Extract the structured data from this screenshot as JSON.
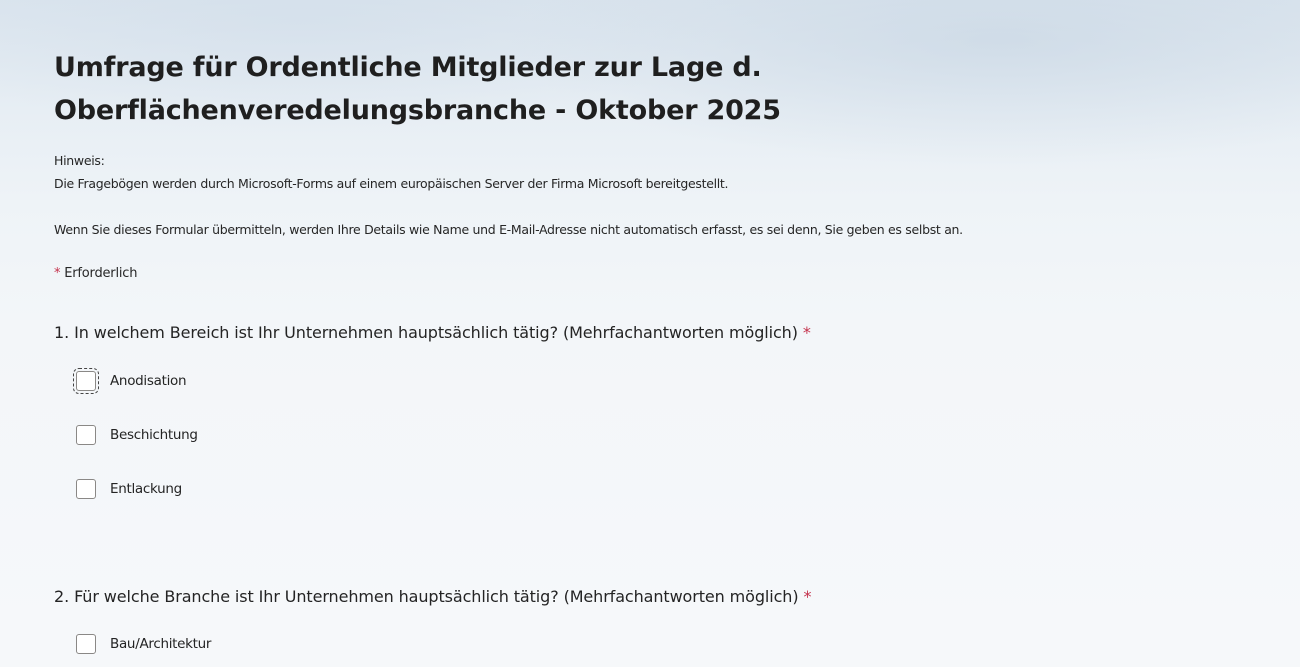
{
  "form": {
    "title": "Umfrage für Ordentliche Mitglieder zur Lage d. Oberflächenveredelungsbranche - Oktober 2025",
    "description": {
      "line1": "Hinweis:",
      "line2": "Die Fragebögen werden durch Microsoft-Forms auf einem europäischen Server der Firma Microsoft bereitgestellt.",
      "line3": "Wenn Sie dieses Formular übermitteln, werden Ihre Details wie Name und E-Mail-Adresse nicht automatisch erfasst, es sei denn, Sie geben es selbst an."
    },
    "required_marker": "*",
    "required_label": "Erforderlich"
  },
  "questions": [
    {
      "number": "1.",
      "text": "In welchem Bereich ist Ihr Unternehmen hauptsächlich tätig? (Mehrfachantworten möglich)",
      "required_marker": "*",
      "options": [
        {
          "label": "Anodisation",
          "checked": false
        },
        {
          "label": "Beschichtung",
          "checked": false
        },
        {
          "label": "Entlackung",
          "checked": false
        }
      ]
    },
    {
      "number": "2.",
      "text": "Für welche Branche ist Ihr Unternehmen hauptsächlich tätig? (Mehrfachantworten möglich)",
      "required_marker": "*",
      "options": [
        {
          "label": "Bau/Architektur",
          "checked": false
        }
      ]
    }
  ],
  "colors": {
    "required": "#c4314b",
    "text": "#242424"
  }
}
